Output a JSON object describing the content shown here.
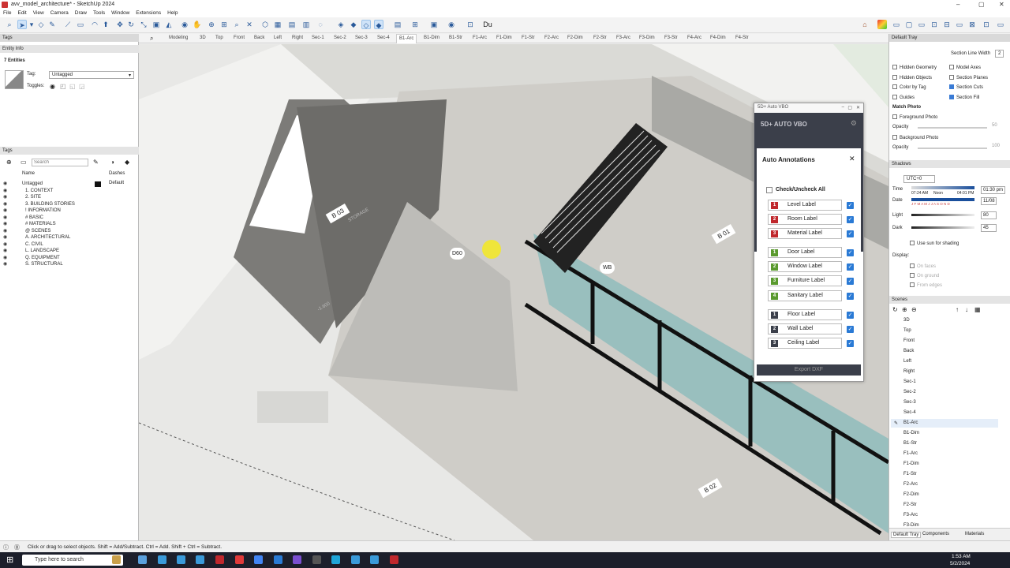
{
  "window": {
    "title": "avv_model_architecture* - SketchUp 2024"
  },
  "menu": [
    "File",
    "Edit",
    "View",
    "Camera",
    "Draw",
    "Tools",
    "Window",
    "Extensions",
    "Help"
  ],
  "toolbar": {
    "text_tool": "Du"
  },
  "scene_tabs": [
    "Modeling",
    "3D",
    "Top",
    "Front",
    "Back",
    "Left",
    "Right",
    "Sec-1",
    "Sec-2",
    "Sec-3",
    "Sec-4",
    "B1-Arc",
    "B1-Dim",
    "B1-Str",
    "F1-Arc",
    "F1-Dim",
    "F1-Str",
    "F2-Arc",
    "F2-Dim",
    "F2-Str",
    "F3-Arc",
    "F3-Dim",
    "F3-Str",
    "F4-Arc",
    "F4-Dim",
    "F4-Str"
  ],
  "active_scene_tab": "B1-Arc",
  "left": {
    "tags_title": "Tags",
    "entity_info": {
      "title": "Entity Info",
      "count": "7 Entities",
      "tag_label": "Tag:",
      "tag_value": "Untagged",
      "toggles_label": "Toggles:"
    },
    "tags_panel": {
      "title": "Tags",
      "search_placeholder": "Search",
      "col_name": "Name",
      "col_dashes": "Dashes",
      "rows": [
        {
          "name": "Untagged",
          "dashes": "Default"
        },
        {
          "name": "1. CONTEXT"
        },
        {
          "name": "2. SITE"
        },
        {
          "name": "3. BUILDING STORIES"
        },
        {
          "name": "! INFORMATION"
        },
        {
          "name": "# BASIC"
        },
        {
          "name": "# MATERIALS"
        },
        {
          "name": "@ SCENES"
        },
        {
          "name": "A. ARCHITECTURAL"
        },
        {
          "name": "C. CIVIL"
        },
        {
          "name": "L. LANDSCAPE"
        },
        {
          "name": "Q. EQUIPMENT"
        },
        {
          "name": "S. STRUCTURAL"
        }
      ]
    }
  },
  "viewport_labels": {
    "b01_a": "B 01",
    "b01_b": "B 01",
    "b02": "B 02",
    "b03": "B 03",
    "storage": "STORAGE",
    "wb": "WB",
    "d60": "D60",
    "elev1": "-1.600",
    "elev2": "-1.600"
  },
  "vbo": {
    "window_title": "5D+ Auto VBO",
    "brand": "5D+  AUTO VBO",
    "dialog_title": "Auto Annotations",
    "check_all": "Check/Uncheck All",
    "items": [
      {
        "num": "1",
        "label": "Level Label",
        "color": "#c0282d"
      },
      {
        "num": "2",
        "label": "Room Label",
        "color": "#c0282d"
      },
      {
        "num": "3",
        "label": "Material Label",
        "color": "#c0282d"
      },
      {
        "num": "1",
        "label": "Door Label",
        "color": "#5a9a2e"
      },
      {
        "num": "2",
        "label": "Window Label",
        "color": "#5a9a2e"
      },
      {
        "num": "3",
        "label": "Furniture Label",
        "color": "#5a9a2e"
      },
      {
        "num": "4",
        "label": "Sanitary Label",
        "color": "#5a9a2e"
      },
      {
        "num": "1",
        "label": "Floor Label",
        "color": "#3b3f4a"
      },
      {
        "num": "2",
        "label": "Wall Label",
        "color": "#3b3f4a"
      },
      {
        "num": "3",
        "label": "Ceiling Label",
        "color": "#3b3f4a"
      }
    ],
    "export_label": "Export DXF"
  },
  "right": {
    "tray_title": "Default Tray",
    "section_line_width": "Section Line Width",
    "section_line_value": "2",
    "checks": [
      {
        "label": "Hidden Geometry",
        "on": false
      },
      {
        "label": "Model Axes",
        "on": false
      },
      {
        "label": "Hidden Objects",
        "on": false
      },
      {
        "label": "Section Planes",
        "on": false
      },
      {
        "label": "Color by Tag",
        "on": false
      },
      {
        "label": "Section Cuts",
        "on": true
      },
      {
        "label": "Guides",
        "on": false
      },
      {
        "label": "Section Fill",
        "on": true
      }
    ],
    "match_photo": "Match Photo",
    "foreground_photo": "Foreground Photo",
    "opacity": "Opacity",
    "opacity_val1": "50",
    "background_photo": "Background Photo",
    "opacity_val2": "100",
    "shadows_title": "Shadows",
    "utc": "UTC+0",
    "time_label": "Time",
    "time_start": "07:24 AM",
    "noon": "Noon",
    "time_end": "04:01 PM",
    "time_value": "01:30 pm",
    "date_label": "Date",
    "months": "J F M A M J J A S O N D",
    "date_value": "11/08",
    "light_label": "Light",
    "light_value": "80",
    "dark_label": "Dark",
    "dark_value": "45",
    "use_sun": "Use sun for shading",
    "display": "Display:",
    "on_faces": "On faces",
    "on_ground": "On ground",
    "from_edges": "From edges",
    "scenes_title": "Scenes",
    "scenes": [
      "3D",
      "Top",
      "Front",
      "Back",
      "Left",
      "Right",
      "Sec-1",
      "Sec-2",
      "Sec-3",
      "Sec-4",
      "B1-Arc",
      "B1-Dim",
      "B1-Str",
      "F1-Arc",
      "F1-Dim",
      "F1-Str",
      "F2-Arc",
      "F2-Dim",
      "F2-Str",
      "F3-Arc",
      "F3-Dim"
    ],
    "active_scene": "B1-Arc",
    "bottom_tabs": [
      "Default Tray",
      "Components",
      "Materials"
    ]
  },
  "status": {
    "text": "Click or drag to select objects. Shift = Add/Subtract. Ctrl = Add. Shift + Ctrl = Subtract."
  },
  "taskbar": {
    "search_placeholder": "Type here to search",
    "time": "1:53 AM",
    "date": "5/2/2024"
  }
}
